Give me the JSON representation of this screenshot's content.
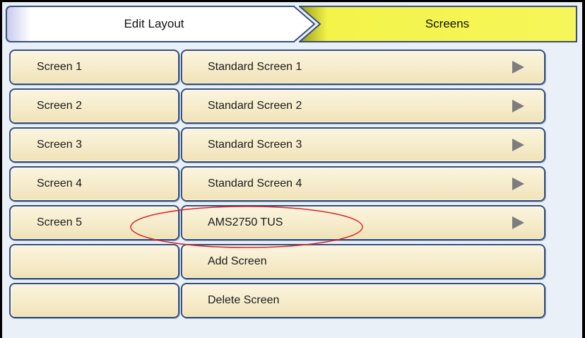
{
  "header": {
    "breadcrumb_current": "Edit Layout",
    "breadcrumb_next": "Screens"
  },
  "rows": [
    {
      "name": "Screen 1",
      "screen": "Standard Screen 1",
      "has_arrow": true
    },
    {
      "name": "Screen 2",
      "screen": "Standard Screen 2",
      "has_arrow": true
    },
    {
      "name": "Screen 3",
      "screen": "Standard Screen 3",
      "has_arrow": true
    },
    {
      "name": "Screen 4",
      "screen": "Standard Screen 4",
      "has_arrow": true
    },
    {
      "name": "Screen 5",
      "screen": "AMS2750 TUS",
      "has_arrow": true
    },
    {
      "name": "",
      "screen": "Add Screen",
      "has_arrow": false
    },
    {
      "name": "",
      "screen": "Delete Screen",
      "has_arrow": false
    }
  ],
  "icons": {
    "row_arrow": "play-arrow-icon"
  },
  "colors": {
    "header_yellow": "#f5f547",
    "button_cream": "#f6eccb",
    "button_border": "#35507a",
    "highlight_ellipse": "#d9262a",
    "arrow_gray": "#7d7d7d"
  }
}
